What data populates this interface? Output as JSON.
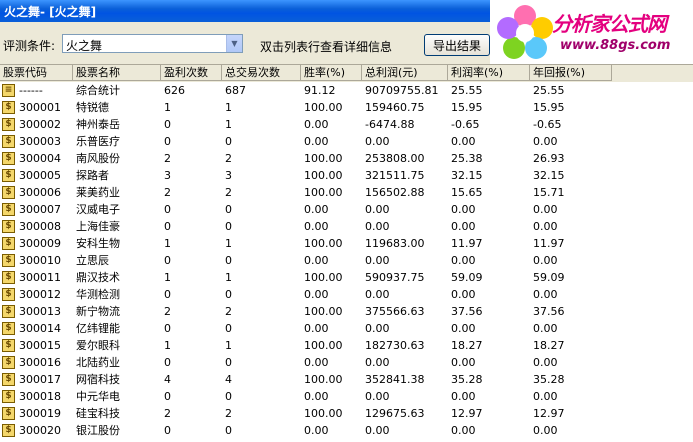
{
  "window": {
    "title": "火之舞- [火之舞]"
  },
  "toolbar": {
    "condition_label": "评测条件:",
    "condition_value": "火之舞",
    "hint": "双击列表行查看详细信息",
    "export_label": "导出结果"
  },
  "logo": {
    "brand": "分析家公式网",
    "url": "www.88gs.com"
  },
  "colors": {
    "titlebar": "#0054e3",
    "logo_text": "#e4007f",
    "row_icon": "#f4d76b"
  },
  "table": {
    "columns": [
      "股票代码",
      "股票名称",
      "盈利次数",
      "总交易次数",
      "胜率(%)",
      "总利润(元)",
      "利润率(%)",
      "年回报(%)"
    ],
    "rows": [
      {
        "code": "------",
        "name": "综合统计",
        "win": "626",
        "trades": "687",
        "rate": "91.12",
        "profit": "90709755.81",
        "pr": "25.55",
        "annual": "25.55",
        "icon": "summary-icon"
      },
      {
        "code": "300001",
        "name": "特锐德",
        "win": "1",
        "trades": "1",
        "rate": "100.00",
        "profit": "159460.75",
        "pr": "15.95",
        "annual": "15.95",
        "icon": "stock-icon"
      },
      {
        "code": "300002",
        "name": "神州泰岳",
        "win": "0",
        "trades": "1",
        "rate": "0.00",
        "profit": "-6474.88",
        "pr": "-0.65",
        "annual": "-0.65",
        "icon": "stock-icon"
      },
      {
        "code": "300003",
        "name": "乐普医疗",
        "win": "0",
        "trades": "0",
        "rate": "0.00",
        "profit": "0.00",
        "pr": "0.00",
        "annual": "0.00",
        "icon": "stock-icon"
      },
      {
        "code": "300004",
        "name": "南风股份",
        "win": "2",
        "trades": "2",
        "rate": "100.00",
        "profit": "253808.00",
        "pr": "25.38",
        "annual": "26.93",
        "icon": "stock-icon"
      },
      {
        "code": "300005",
        "name": "探路者",
        "win": "3",
        "trades": "3",
        "rate": "100.00",
        "profit": "321511.75",
        "pr": "32.15",
        "annual": "32.15",
        "icon": "stock-icon"
      },
      {
        "code": "300006",
        "name": "莱美药业",
        "win": "2",
        "trades": "2",
        "rate": "100.00",
        "profit": "156502.88",
        "pr": "15.65",
        "annual": "15.71",
        "icon": "stock-icon"
      },
      {
        "code": "300007",
        "name": "汉威电子",
        "win": "0",
        "trades": "0",
        "rate": "0.00",
        "profit": "0.00",
        "pr": "0.00",
        "annual": "0.00",
        "icon": "stock-icon"
      },
      {
        "code": "300008",
        "name": "上海佳豪",
        "win": "0",
        "trades": "0",
        "rate": "0.00",
        "profit": "0.00",
        "pr": "0.00",
        "annual": "0.00",
        "icon": "stock-icon"
      },
      {
        "code": "300009",
        "name": "安科生物",
        "win": "1",
        "trades": "1",
        "rate": "100.00",
        "profit": "119683.00",
        "pr": "11.97",
        "annual": "11.97",
        "icon": "stock-icon"
      },
      {
        "code": "300010",
        "name": "立思辰",
        "win": "0",
        "trades": "0",
        "rate": "0.00",
        "profit": "0.00",
        "pr": "0.00",
        "annual": "0.00",
        "icon": "stock-icon"
      },
      {
        "code": "300011",
        "name": "鼎汉技术",
        "win": "1",
        "trades": "1",
        "rate": "100.00",
        "profit": "590937.75",
        "pr": "59.09",
        "annual": "59.09",
        "icon": "stock-icon"
      },
      {
        "code": "300012",
        "name": "华测检测",
        "win": "0",
        "trades": "0",
        "rate": "0.00",
        "profit": "0.00",
        "pr": "0.00",
        "annual": "0.00",
        "icon": "stock-icon"
      },
      {
        "code": "300013",
        "name": "新宁物流",
        "win": "2",
        "trades": "2",
        "rate": "100.00",
        "profit": "375566.63",
        "pr": "37.56",
        "annual": "37.56",
        "icon": "stock-icon"
      },
      {
        "code": "300014",
        "name": "亿纬锂能",
        "win": "0",
        "trades": "0",
        "rate": "0.00",
        "profit": "0.00",
        "pr": "0.00",
        "annual": "0.00",
        "icon": "stock-icon"
      },
      {
        "code": "300015",
        "name": "爱尔眼科",
        "win": "1",
        "trades": "1",
        "rate": "100.00",
        "profit": "182730.63",
        "pr": "18.27",
        "annual": "18.27",
        "icon": "stock-icon"
      },
      {
        "code": "300016",
        "name": "北陆药业",
        "win": "0",
        "trades": "0",
        "rate": "0.00",
        "profit": "0.00",
        "pr": "0.00",
        "annual": "0.00",
        "icon": "stock-icon"
      },
      {
        "code": "300017",
        "name": "网宿科技",
        "win": "4",
        "trades": "4",
        "rate": "100.00",
        "profit": "352841.38",
        "pr": "35.28",
        "annual": "35.28",
        "icon": "stock-icon"
      },
      {
        "code": "300018",
        "name": "中元华电",
        "win": "0",
        "trades": "0",
        "rate": "0.00",
        "profit": "0.00",
        "pr": "0.00",
        "annual": "0.00",
        "icon": "stock-icon"
      },
      {
        "code": "300019",
        "name": "硅宝科技",
        "win": "2",
        "trades": "2",
        "rate": "100.00",
        "profit": "129675.63",
        "pr": "12.97",
        "annual": "12.97",
        "icon": "stock-icon"
      },
      {
        "code": "300020",
        "name": "银江股份",
        "win": "0",
        "trades": "0",
        "rate": "0.00",
        "profit": "0.00",
        "pr": "0.00",
        "annual": "0.00",
        "icon": "stock-icon"
      }
    ]
  }
}
